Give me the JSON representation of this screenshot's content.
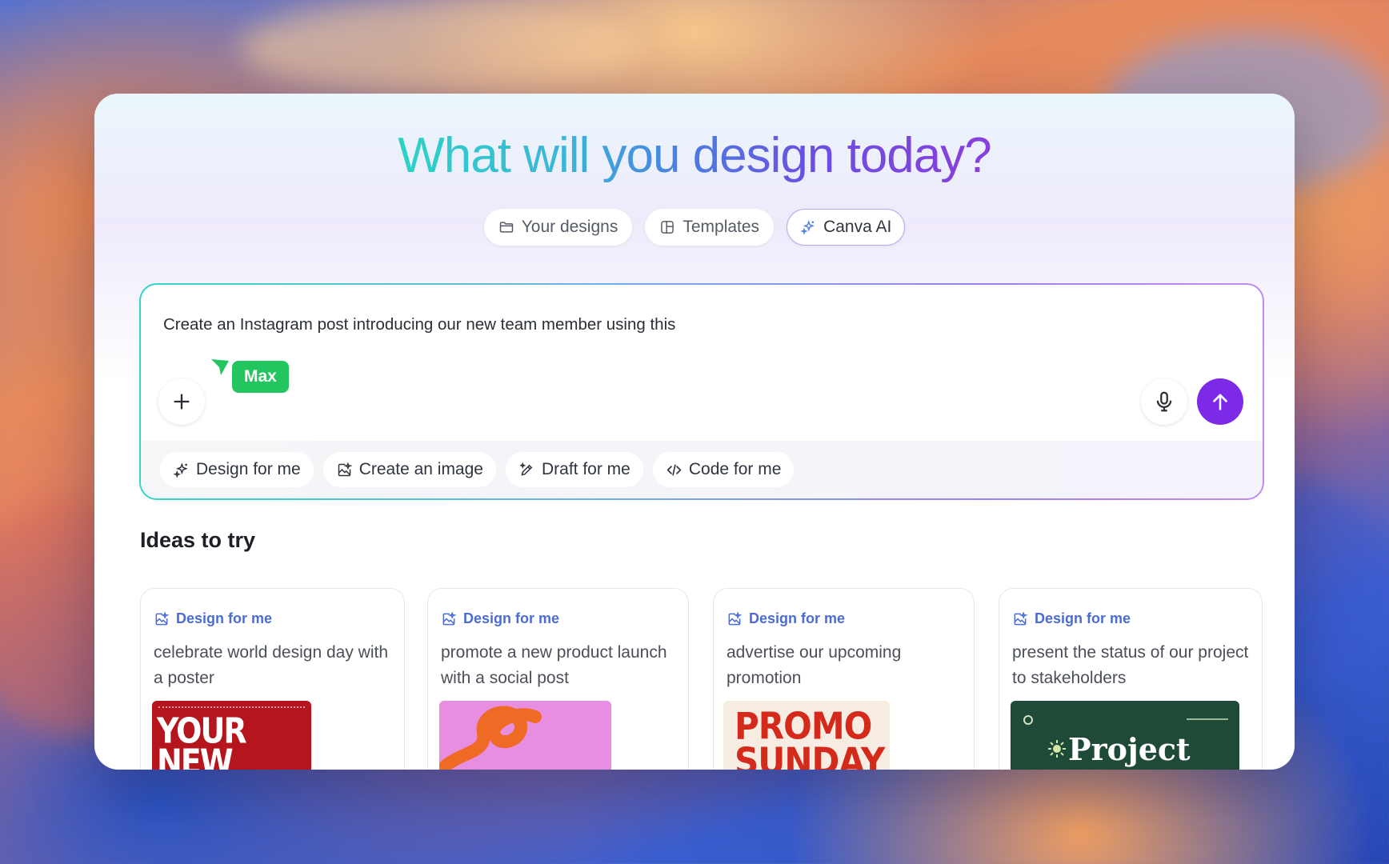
{
  "header": {
    "title": "What will you design today?"
  },
  "tabs": [
    {
      "label": "Your designs",
      "icon": "folder-icon",
      "active": false
    },
    {
      "label": "Templates",
      "icon": "templates-icon",
      "active": false
    },
    {
      "label": "Canva AI",
      "icon": "sparkle-icon",
      "active": true
    }
  ],
  "prompt": {
    "text": "Create an Instagram post introducing our new team member using this",
    "collaborator_cursor": {
      "name": "Max",
      "color": "#22c55e"
    },
    "add_icon": "plus-icon",
    "mic_icon": "microphone-icon",
    "send_icon": "arrow-up-icon",
    "send_color": "#7d2ae8"
  },
  "chips": [
    {
      "label": "Design for me",
      "icon": "sparkle-icon"
    },
    {
      "label": "Create an image",
      "icon": "image-edit-icon"
    },
    {
      "label": "Draft for me",
      "icon": "pen-sparkle-icon"
    },
    {
      "label": "Code for me",
      "icon": "code-icon"
    }
  ],
  "ideas": {
    "title": "Ideas to try",
    "cards": [
      {
        "label": "Design for me",
        "description": "celebrate world design day with a poster",
        "thumb_text": "YOUR NEW STYLE!"
      },
      {
        "label": "Design for me",
        "description": "promote a new product launch with a social post",
        "thumb_text": ""
      },
      {
        "label": "Design for me",
        "description": "advertise our upcoming promotion",
        "thumb_text": "PROMO SUNDAY"
      },
      {
        "label": "Design for me",
        "description": "present the status of our project to stakeholders",
        "thumb_text": "Project"
      }
    ]
  }
}
